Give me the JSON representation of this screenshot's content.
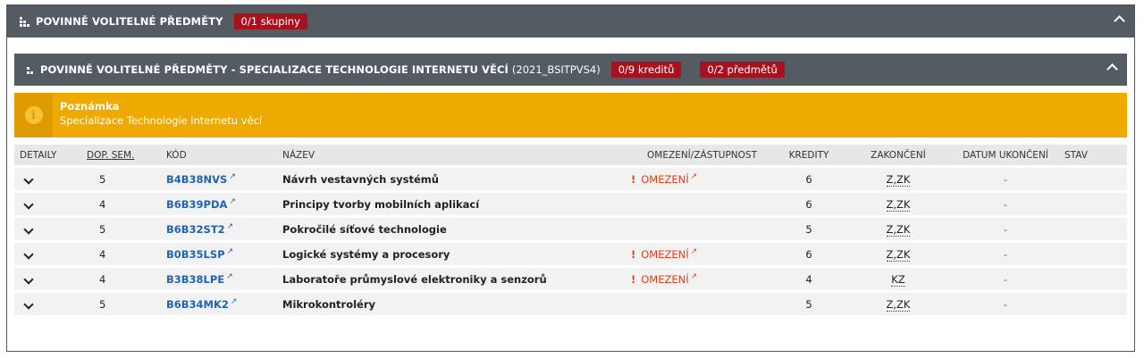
{
  "outer": {
    "title": "POVINNĚ VOLITELNÉ PŘEDMĚTY",
    "badge": "0/1 skupiny"
  },
  "inner": {
    "title": "POVINNĚ VOLITELNÉ PŘEDMĚTY - SPECIALIZACE TECHNOLOGIE INTERNETU VĚCÍ",
    "subtitle": "(2021_BSITPVS4)",
    "badge_credits": "0/9 kreditů",
    "badge_subjects": "0/2 předmětů"
  },
  "note": {
    "title": "Poznámka",
    "text": "Specializace Technologie internetu věcí"
  },
  "table": {
    "headers": [
      "DETAILY",
      "DOP. SEM.",
      "KÓD",
      "NÁZEV",
      "OMEZENÍ/ZÁSTUPNOST",
      "KREDITY",
      "ZAKONČENÍ",
      "DATUM UKONČENÍ",
      "STAV"
    ],
    "rows": [
      {
        "sem": "5",
        "code": "B4B38NVS",
        "name": "Návrh vestavných systémů",
        "restriction": "OMEZENÍ",
        "credits": "6",
        "completion": "Z,ZK",
        "date": "-"
      },
      {
        "sem": "4",
        "code": "B6B39PDA",
        "name": "Principy tvorby mobilních aplikací",
        "restriction": "",
        "credits": "6",
        "completion": "Z,ZK",
        "date": "-"
      },
      {
        "sem": "5",
        "code": "B6B32ST2",
        "name": "Pokročilé síťové technologie",
        "restriction": "",
        "credits": "5",
        "completion": "Z,ZK",
        "date": "-"
      },
      {
        "sem": "4",
        "code": "B0B35LSP",
        "name": "Logické systémy a procesory",
        "restriction": "OMEZENÍ",
        "credits": "6",
        "completion": "Z,ZK",
        "date": "-"
      },
      {
        "sem": "4",
        "code": "B3B38LPE",
        "name": "Laboratoře průmyslové elektroniky a senzorů",
        "restriction": "OMEZENÍ",
        "credits": "4",
        "completion": "KZ",
        "date": "-"
      },
      {
        "sem": "5",
        "code": "B6B34MK2",
        "name": "Mikrokontroléry",
        "restriction": "",
        "credits": "5",
        "completion": "Z,ZK",
        "date": "-"
      }
    ]
  },
  "icons": {
    "group": "group-icon",
    "collapse": "chevron-up-icon",
    "expand": "chevron-down-icon",
    "info": "info-icon",
    "external": "external-link-icon"
  },
  "colors": {
    "header": "#545b62",
    "badge": "#a8121f",
    "note": "#eeaa00",
    "link": "#1f64b0",
    "warn": "#e0401a"
  }
}
